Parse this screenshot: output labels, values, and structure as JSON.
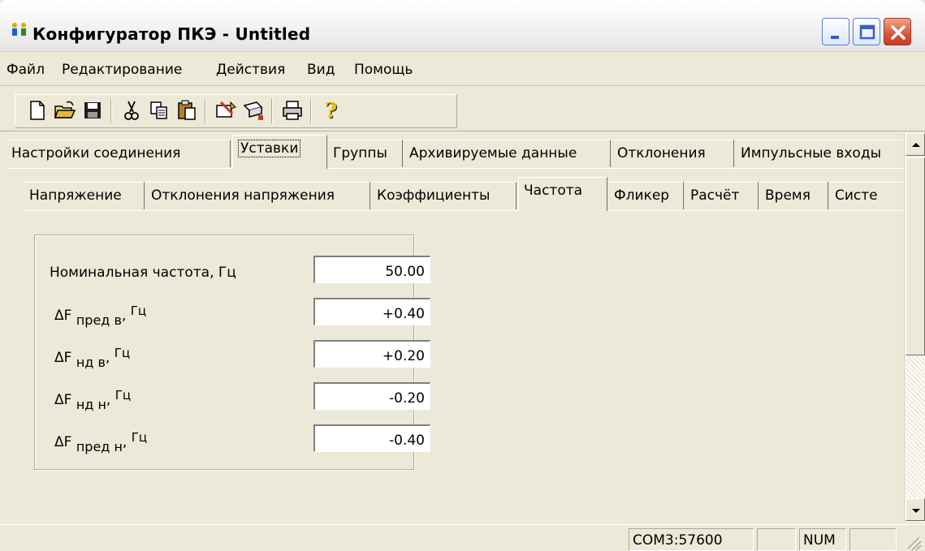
{
  "window": {
    "title": "Конфигуратор ПКЭ - Untitled"
  },
  "colors": {
    "window_face": "#ece9d8",
    "close_button": "#d7563a"
  },
  "icons": {
    "app": "people-icon",
    "toolbar": [
      "new-file-icon",
      "open-folder-icon",
      "save-floppy-icon",
      "cut-scissors-icon",
      "copy-icon",
      "paste-clipboard-icon",
      "read-device-icon",
      "write-device-icon",
      "print-icon",
      "help-question-icon"
    ]
  },
  "menu": {
    "items": [
      "Файл",
      "Редактирование",
      "Действия",
      "Вид",
      "Помощь"
    ]
  },
  "tabs_row1": {
    "items": [
      "Настройки соединения",
      "Уставки",
      "Группы",
      "Архивируемые данные",
      "Отклонения",
      "Импульсные входы"
    ],
    "active": "Уставки"
  },
  "tabs_row2": {
    "items": [
      "Напряжение",
      "Отклонения напряжения",
      "Коэффициенты",
      "Частота",
      "Фликер",
      "Расчёт",
      "Время",
      "Систе"
    ],
    "active": "Частота"
  },
  "frequency": {
    "nominal": {
      "label": "Номинальная частота, Гц",
      "value": "50.00"
    },
    "f_pred_v": {
      "prefix": "ΔF",
      "sub": "пред в",
      "sep": ",",
      "sup": "Гц",
      "value": "+0.40"
    },
    "f_nd_v": {
      "prefix": "ΔF",
      "sub": "нд в",
      "sep": ",",
      "sup": "Гц",
      "value": "+0.20"
    },
    "f_nd_n": {
      "prefix": "ΔF",
      "sub": "нд н",
      "sep": ",",
      "sup": "Гц",
      "value": "-0.20"
    },
    "f_pred_n": {
      "prefix": "ΔF",
      "sub": "пред н",
      "sep": ",",
      "sup": "Гц",
      "value": "-0.40"
    }
  },
  "status": {
    "port": "COM3:57600",
    "num": "NUM"
  }
}
